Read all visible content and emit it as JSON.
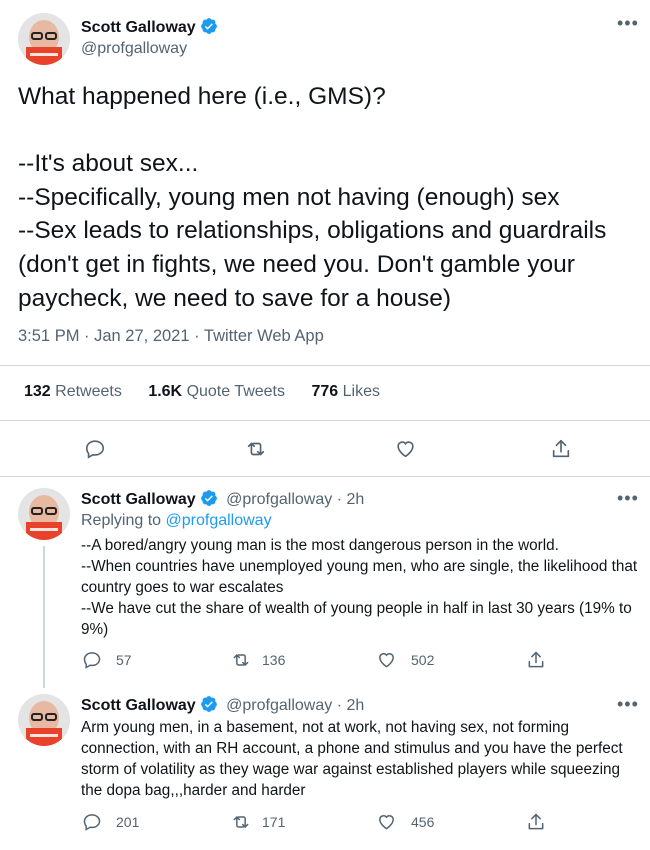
{
  "main_tweet": {
    "author_name": "Scott Galloway",
    "author_handle": "@profgalloway",
    "text": "What happened here (i.e., GMS)?\n\n--It's about sex...\n--Specifically, young men not having (enough) sex\n--Sex leads to relationships, obligations and guardrails (don't get in fights, we need you.  Don't gamble your paycheck, we need to save for a house)",
    "time": "3:51 PM",
    "date": "Jan 27, 2021",
    "source": "Twitter Web App",
    "separator": " · ",
    "retweets_count": "132",
    "retweets_label": "Retweets",
    "quote_count": "1.6K",
    "quote_label": "Quote Tweets",
    "likes_count": "776",
    "likes_label": "Likes"
  },
  "replies": [
    {
      "author_name": "Scott Galloway",
      "author_handle": "@profgalloway",
      "age": "· 2h",
      "replying_label": "Replying to",
      "replying_handle": "@profgalloway",
      "text": "--A bored/angry young man is the most dangerous person in the world.\n--When countries have unemployed young men, who are single, the likelihood that country goes to war escalates\n--We have cut the share of wealth of young people in half in last 30 years (19% to 9%)",
      "replies_count": "57",
      "retweets_count": "136",
      "likes_count": "502"
    },
    {
      "author_name": "Scott Galloway",
      "author_handle": "@profgalloway",
      "age": "· 2h",
      "text": "Arm young men, in a basement, not at work, not having sex, not forming connection, with an RH account, a phone and stimulus and you have the perfect storm of volatility as they wage war against established players while squeezing the dopa bag,,,harder and harder",
      "replies_count": "201",
      "retweets_count": "171",
      "likes_count": "456"
    }
  ],
  "icons": {
    "more": "more-icon",
    "verified": "verified-badge-icon",
    "reply": "reply-icon",
    "retweet": "retweet-icon",
    "like": "heart-icon",
    "share": "share-icon"
  },
  "colors": {
    "text": "#0f1419",
    "secondary": "#536471",
    "accent": "#1d9bf0",
    "divider": "#cfd9de",
    "book_red": "#e8432a"
  }
}
